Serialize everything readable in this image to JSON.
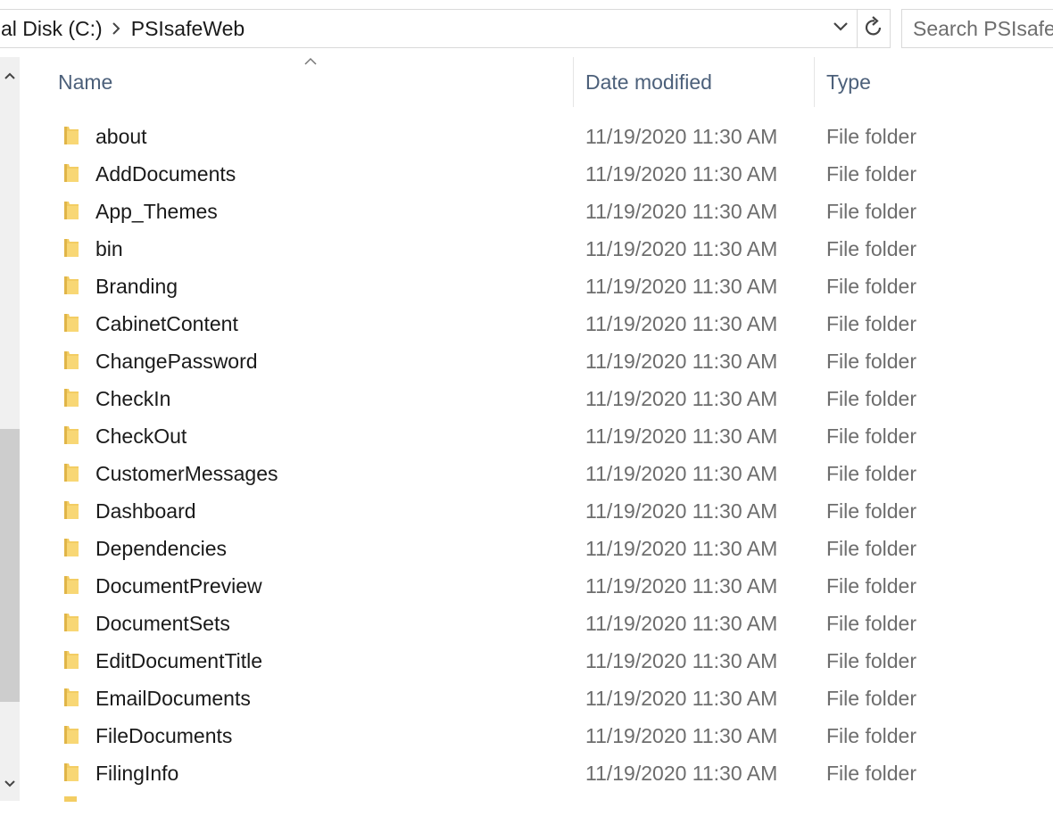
{
  "address": {
    "crumbs": [
      "al Disk (C:)",
      "PSIsafeWeb"
    ]
  },
  "search": {
    "placeholder": "Search PSIsafeWeb"
  },
  "columns": {
    "name": "Name",
    "date": "Date modified",
    "type": "Type"
  },
  "files": [
    {
      "name": "about",
      "date": "11/19/2020 11:30 AM",
      "type": "File folder"
    },
    {
      "name": "AddDocuments",
      "date": "11/19/2020 11:30 AM",
      "type": "File folder"
    },
    {
      "name": "App_Themes",
      "date": "11/19/2020 11:30 AM",
      "type": "File folder"
    },
    {
      "name": "bin",
      "date": "11/19/2020 11:30 AM",
      "type": "File folder"
    },
    {
      "name": "Branding",
      "date": "11/19/2020 11:30 AM",
      "type": "File folder"
    },
    {
      "name": "CabinetContent",
      "date": "11/19/2020 11:30 AM",
      "type": "File folder"
    },
    {
      "name": "ChangePassword",
      "date": "11/19/2020 11:30 AM",
      "type": "File folder"
    },
    {
      "name": "CheckIn",
      "date": "11/19/2020 11:30 AM",
      "type": "File folder"
    },
    {
      "name": "CheckOut",
      "date": "11/19/2020 11:30 AM",
      "type": "File folder"
    },
    {
      "name": "CustomerMessages",
      "date": "11/19/2020 11:30 AM",
      "type": "File folder"
    },
    {
      "name": "Dashboard",
      "date": "11/19/2020 11:30 AM",
      "type": "File folder"
    },
    {
      "name": "Dependencies",
      "date": "11/19/2020 11:30 AM",
      "type": "File folder"
    },
    {
      "name": "DocumentPreview",
      "date": "11/19/2020 11:30 AM",
      "type": "File folder"
    },
    {
      "name": "DocumentSets",
      "date": "11/19/2020 11:30 AM",
      "type": "File folder"
    },
    {
      "name": "EditDocumentTitle",
      "date": "11/19/2020 11:30 AM",
      "type": "File folder"
    },
    {
      "name": "EmailDocuments",
      "date": "11/19/2020 11:30 AM",
      "type": "File folder"
    },
    {
      "name": "FileDocuments",
      "date": "11/19/2020 11:30 AM",
      "type": "File folder"
    },
    {
      "name": "FilingInfo",
      "date": "11/19/2020 11:30 AM",
      "type": "File folder"
    }
  ],
  "icons": {
    "folder": "folder-icon",
    "breadcrumb_separator": "chevron-right-icon",
    "dropdown": "chevron-down-icon",
    "refresh": "refresh-icon",
    "sort": "sort-ascending-icon",
    "scroll_up": "scroll-up-icon",
    "scroll_down": "scroll-down-icon"
  },
  "colors": {
    "folder": "#f3cd63",
    "header_text": "#4c607a",
    "secondary_text": "#6d6d6d"
  }
}
